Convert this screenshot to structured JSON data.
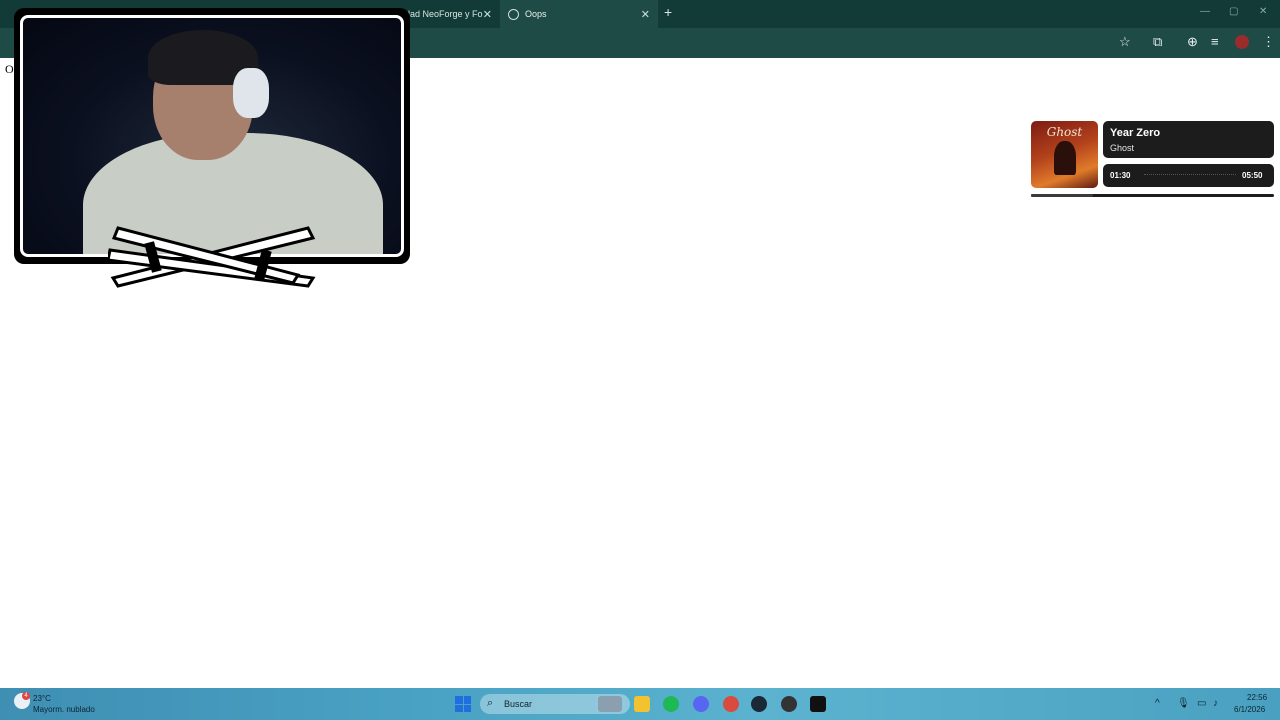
{
  "browser": {
    "tabs": [
      {
        "label": "lad NeoForge y Fo",
        "active": false
      },
      {
        "label": "Oops",
        "active": true
      }
    ],
    "new_tab_icon": "plus-icon",
    "page_text": "O"
  },
  "now_playing": {
    "album_band": "Ghost",
    "title": "Year Zero",
    "artist": "Ghost",
    "time_current": "01:30",
    "time_total": "05:50",
    "progress_fraction": 0.257
  },
  "taskbar": {
    "weather_badge": "4",
    "weather_temp": "23°C",
    "weather_desc": "Mayorm. nublado",
    "search_label": "Buscar",
    "clock_time": "22:56",
    "clock_date": "6/1/2026",
    "apps": [
      "file-explorer-icon",
      "spotify-icon",
      "discord-icon",
      "chrome-icon",
      "steam-icon",
      "notification-icon",
      "capcut-icon"
    ]
  },
  "colors": {
    "chrome_dark": "#123b37",
    "chrome_toolbar": "#1f4b46",
    "widget_bg": "#1c1c1c",
    "taskbar": "#4aa3c4"
  }
}
